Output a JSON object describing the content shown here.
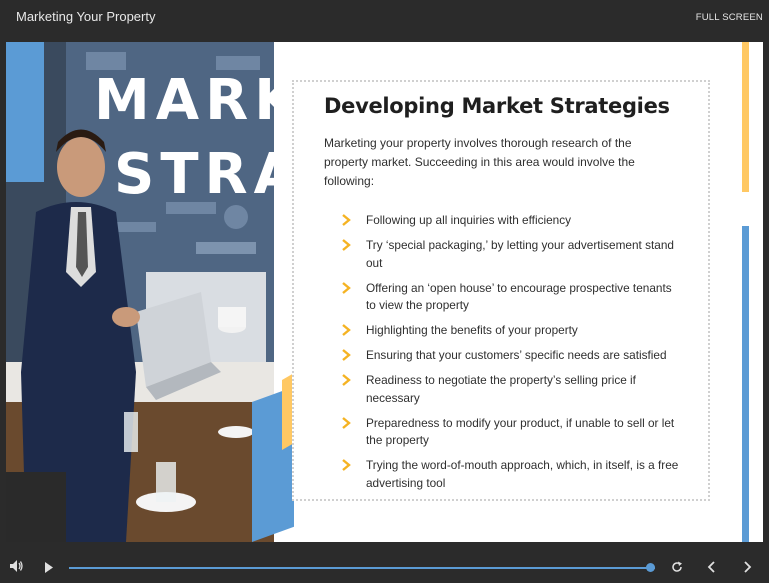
{
  "header": {
    "title": "Marketing Your Property",
    "fullscreen_label": "FULL SCREEN"
  },
  "slide": {
    "photo_text_line1": "MARKE",
    "photo_text_line2": "STRAT",
    "heading": "Developing Market Strategies",
    "intro": "Marketing your property involves thorough research of the property market. Succeeding in this area would involve the following:",
    "bullets": [
      "Following up all inquiries with efficiency",
      "Try ‘special packaging,’ by letting your advertisement stand out",
      "Offering an ‘open house’ to encourage prospective tenants to view the property",
      "Highlighting the benefits of your property",
      "Ensuring that your customers’ specific needs are satisfied",
      "Readiness to negotiate the property’s selling price if necessary",
      "Preparedness to modify your product, if unable to sell or let the property",
      "Trying the word-of-mouth approach, which, in itself, is a free advertising tool"
    ]
  },
  "player": {
    "progress": 1.0,
    "icons": [
      "volume-icon",
      "play-icon",
      "replay-icon",
      "previous-icon",
      "next-icon"
    ]
  },
  "colors": {
    "accent_blue": "#5b9bd5",
    "accent_orange": "#ffc863",
    "bullet_chevron": "#f5b323",
    "chrome_bg": "#2b2b2b"
  }
}
